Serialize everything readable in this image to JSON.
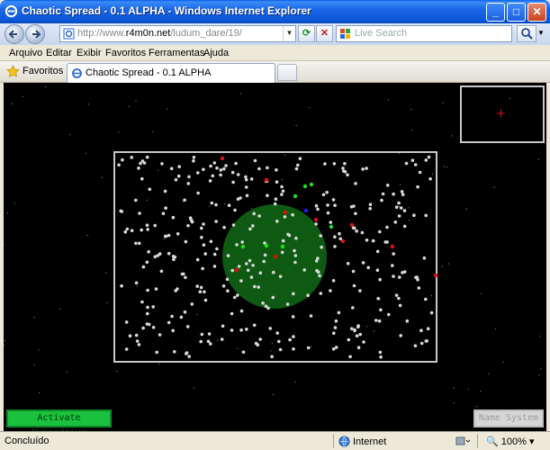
{
  "window": {
    "title": "Chaotic Spread - 0.1 ALPHA - Windows Internet Explorer",
    "min_label": "_",
    "max_label": "□",
    "close_label": "✕"
  },
  "toolbar": {
    "back_icon": "back-arrow-icon",
    "forward_icon": "forward-arrow-icon",
    "url_prefix": "http://www.",
    "url_host": "r4m0n.net",
    "url_path": "/ludum_dare/19/",
    "refresh_label": "⟳",
    "stop_label": "✕",
    "search_placeholder": "Live Search",
    "search_go": "⌕"
  },
  "menu": [
    "Arquivo",
    "Editar",
    "Exibir",
    "Favoritos",
    "Ferramentas",
    "Ajuda"
  ],
  "favbar": {
    "favorites_label": "Favoritos",
    "tab_label": "Chaotic Spread - 0.1 ALPHA"
  },
  "game": {
    "hyperdrive_label": "Activate Hyperdrive",
    "name_system_label": "Name System",
    "colors": {
      "background": "#000000",
      "star": "#d8d8d8",
      "zone_fill": "#0f5a12",
      "frame": "#c8c8c8",
      "red": "#e01010",
      "green": "#22dd22",
      "blue": "#2222ee",
      "hyperdrive_bg": "#19c13c",
      "name_bg": "#d6d6d6"
    }
  },
  "status": {
    "text": "Concluído",
    "zone": "Internet",
    "zoom": "100%"
  }
}
